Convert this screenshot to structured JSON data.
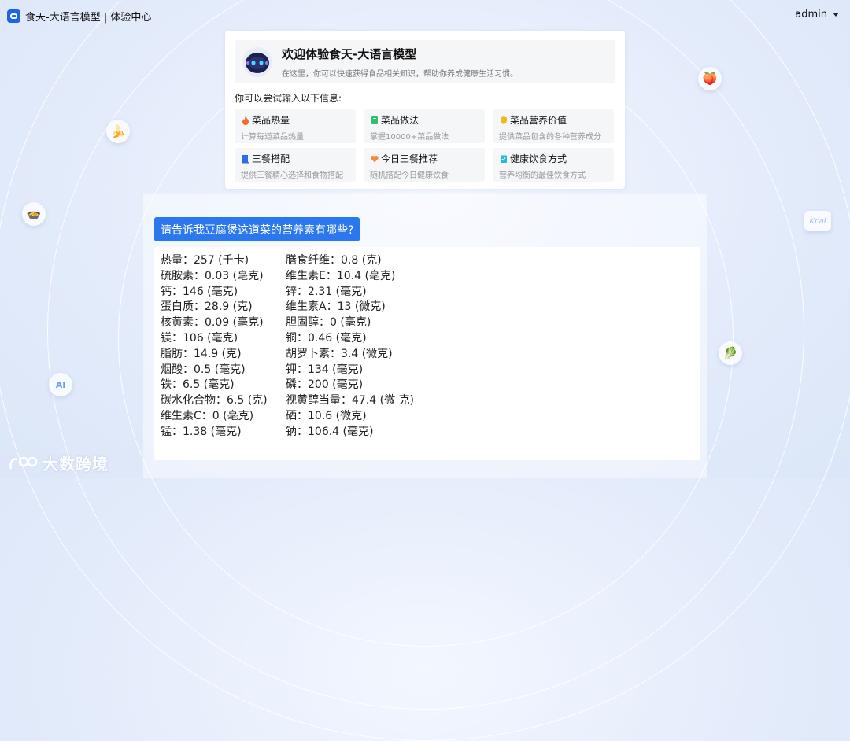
{
  "header": {
    "app_title": "食天-大语言模型 | 体验中心",
    "user": "admin"
  },
  "welcome": {
    "title": "欢迎体验食天-大语言模型",
    "subtitle": "在这里，你可以快速获得食品相关知识，帮助你养成健康生活习惯。",
    "try_label": "你可以尝试输入以下信息:",
    "features": [
      {
        "icon": "fire-icon",
        "title": "菜品热量",
        "desc": "计算每道菜品热量"
      },
      {
        "icon": "recipe-book-icon",
        "title": "菜品做法",
        "desc": "掌握10000+菜品做法"
      },
      {
        "icon": "shield-icon",
        "title": "菜品营养价值",
        "desc": "提供菜品包含的各种营养成分"
      },
      {
        "icon": "meal-book-icon",
        "title": "三餐搭配",
        "desc": "提供三餐精心选择和食物搭配"
      },
      {
        "icon": "heart-icon",
        "title": "今日三餐推荐",
        "desc": "随机搭配今日健康饮食"
      },
      {
        "icon": "clipboard-icon",
        "title": "健康饮食方式",
        "desc": "营养均衡的最佳饮食方式"
      }
    ]
  },
  "chat": {
    "question": "请告诉我豆腐煲这道菜的营养素有哪些?",
    "answer_left": [
      "热量：257 (千卡)",
      "硫胺素：0.03 (毫克)",
      "钙：146 (毫克)",
      "蛋白质：28.9 (克)",
      "核黄素：0.09 (毫克)",
      "镁：106 (毫克)",
      "脂肪：14.9 (克)",
      "烟酸：0.5 (毫克)",
      "铁：6.5 (毫克)",
      "碳水化合物：6.5 (克)",
      "维生素C：0 (毫克)",
      "锰：1.38 (毫克)"
    ],
    "answer_right": [
      "膳食纤维：0.8 (克)",
      "维生素E：10.4 (毫克)",
      "锌：2.31 (毫克)",
      "维生素A：13 (微克)",
      "胆固醇：0 (毫克)",
      "铜：0.46 (毫克)",
      "胡罗卜素：3.4 (微克)",
      "钾：134 (毫克)",
      "磷：200 (毫克)",
      "视黄醇当量：47.4 (微 克)",
      "硒：10.6 (微克)",
      "钠：106.4 (毫克)"
    ]
  },
  "decor": {
    "kcal": "Kcal",
    "ai": "AI",
    "watermark": "大数跨境"
  },
  "colors": {
    "accent": "#2b77ee",
    "logo": "#1e63e9"
  }
}
